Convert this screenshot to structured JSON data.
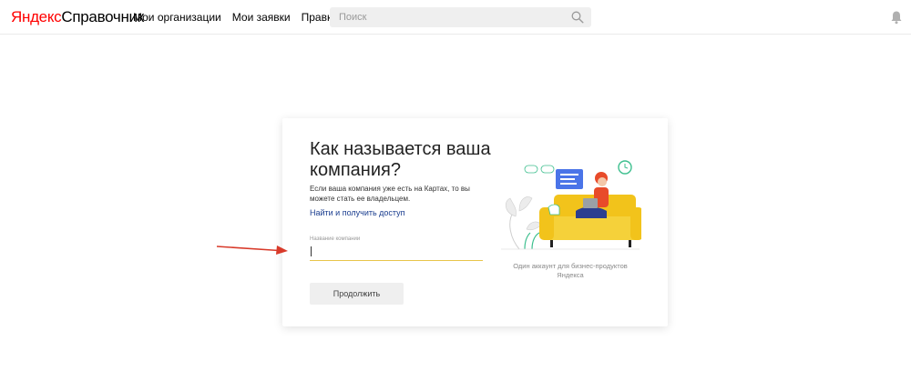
{
  "header": {
    "logo_yandex": "Яндекс",
    "logo_product": "Справочник",
    "nav": [
      {
        "label": "Мои организации"
      },
      {
        "label": "Мои заявки"
      },
      {
        "label": "Правки"
      }
    ],
    "search": {
      "placeholder": "Поиск"
    }
  },
  "card": {
    "title": "Как называется ваша компания?",
    "description": "Если ваша компания уже есть на Картах, то вы можете стать ее владельцем.",
    "find_link": "Найти и получить доступ",
    "field_label": "Название компании",
    "continue_button": "Продолжить",
    "caption": "Один аккаунт для бизнес-продуктов Яндекса"
  },
  "colors": {
    "brand_red": "#ff0000",
    "accent_yellow": "#e8c54a",
    "link_blue": "#1a3d8f",
    "sofa_yellow": "#f2c31b"
  }
}
